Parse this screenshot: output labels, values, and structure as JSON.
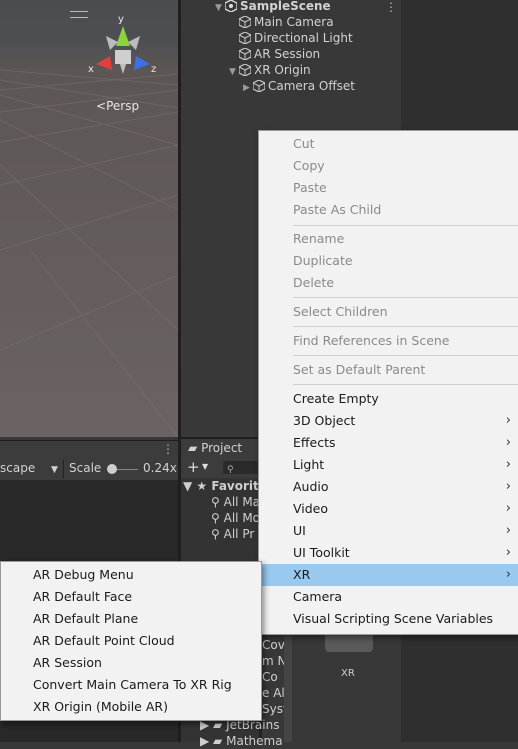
{
  "scene": {
    "persp_label": "Persp",
    "gizmo": {
      "y": "y",
      "x": "x",
      "z": "z"
    }
  },
  "scene_toolbar": {
    "aspect_partial": "scape",
    "scale_label": "Scale",
    "scale_value": "0.24x"
  },
  "hierarchy": {
    "items": [
      {
        "label": "SampleScene",
        "icon": "unity-scene-icon"
      },
      {
        "label": "Main Camera",
        "icon": "gameobject-cube-icon"
      },
      {
        "label": "Directional Light",
        "icon": "gameobject-cube-icon"
      },
      {
        "label": "AR Session",
        "icon": "gameobject-cube-icon"
      },
      {
        "label": "XR Origin",
        "icon": "gameobject-cube-icon"
      },
      {
        "label": "Camera Offset",
        "icon": "gameobject-cube-icon"
      }
    ]
  },
  "project": {
    "tab_label": "Project",
    "favorites_label": "Favorite",
    "favorites": [
      "All Ma",
      "All Mo",
      "All Pr"
    ],
    "folders_partial": [
      "Cov",
      "m N",
      "Co",
      "e Al",
      "Syst",
      "JetBrains",
      "Mathema"
    ],
    "asset_label": "XR"
  },
  "context_menu": {
    "groups": [
      [
        {
          "label": "Cut",
          "disabled": true
        },
        {
          "label": "Copy",
          "disabled": true
        },
        {
          "label": "Paste",
          "disabled": true
        },
        {
          "label": "Paste As Child",
          "disabled": true
        }
      ],
      [
        {
          "label": "Rename",
          "disabled": true
        },
        {
          "label": "Duplicate",
          "disabled": true
        },
        {
          "label": "Delete",
          "disabled": true
        }
      ],
      [
        {
          "label": "Select Children",
          "disabled": true
        }
      ],
      [
        {
          "label": "Find References in Scene",
          "disabled": true
        }
      ],
      [
        {
          "label": "Set as Default Parent",
          "disabled": true
        }
      ],
      [
        {
          "label": "Create Empty"
        },
        {
          "label": "3D Object",
          "submenu": true
        },
        {
          "label": "Effects",
          "submenu": true
        },
        {
          "label": "Light",
          "submenu": true
        },
        {
          "label": "Audio",
          "submenu": true
        },
        {
          "label": "Video",
          "submenu": true
        },
        {
          "label": "UI",
          "submenu": true
        },
        {
          "label": "UI Toolkit",
          "submenu": true
        },
        {
          "label": "XR",
          "submenu": true,
          "highlighted": true
        },
        {
          "label": "Camera"
        },
        {
          "label": "Visual Scripting Scene Variables"
        }
      ]
    ]
  },
  "xr_submenu": {
    "items": [
      "AR Debug Menu",
      "AR Default Face",
      "AR Default Plane",
      "AR Default Point Cloud",
      "AR Session",
      "Convert Main Camera To XR Rig",
      "XR Origin (Mobile AR)"
    ]
  },
  "colors": {
    "menu_highlight": "#99c9ef",
    "gizmo_y": "#8cd43c",
    "gizmo_x": "#e0403a",
    "gizmo_z": "#3c72e8"
  }
}
